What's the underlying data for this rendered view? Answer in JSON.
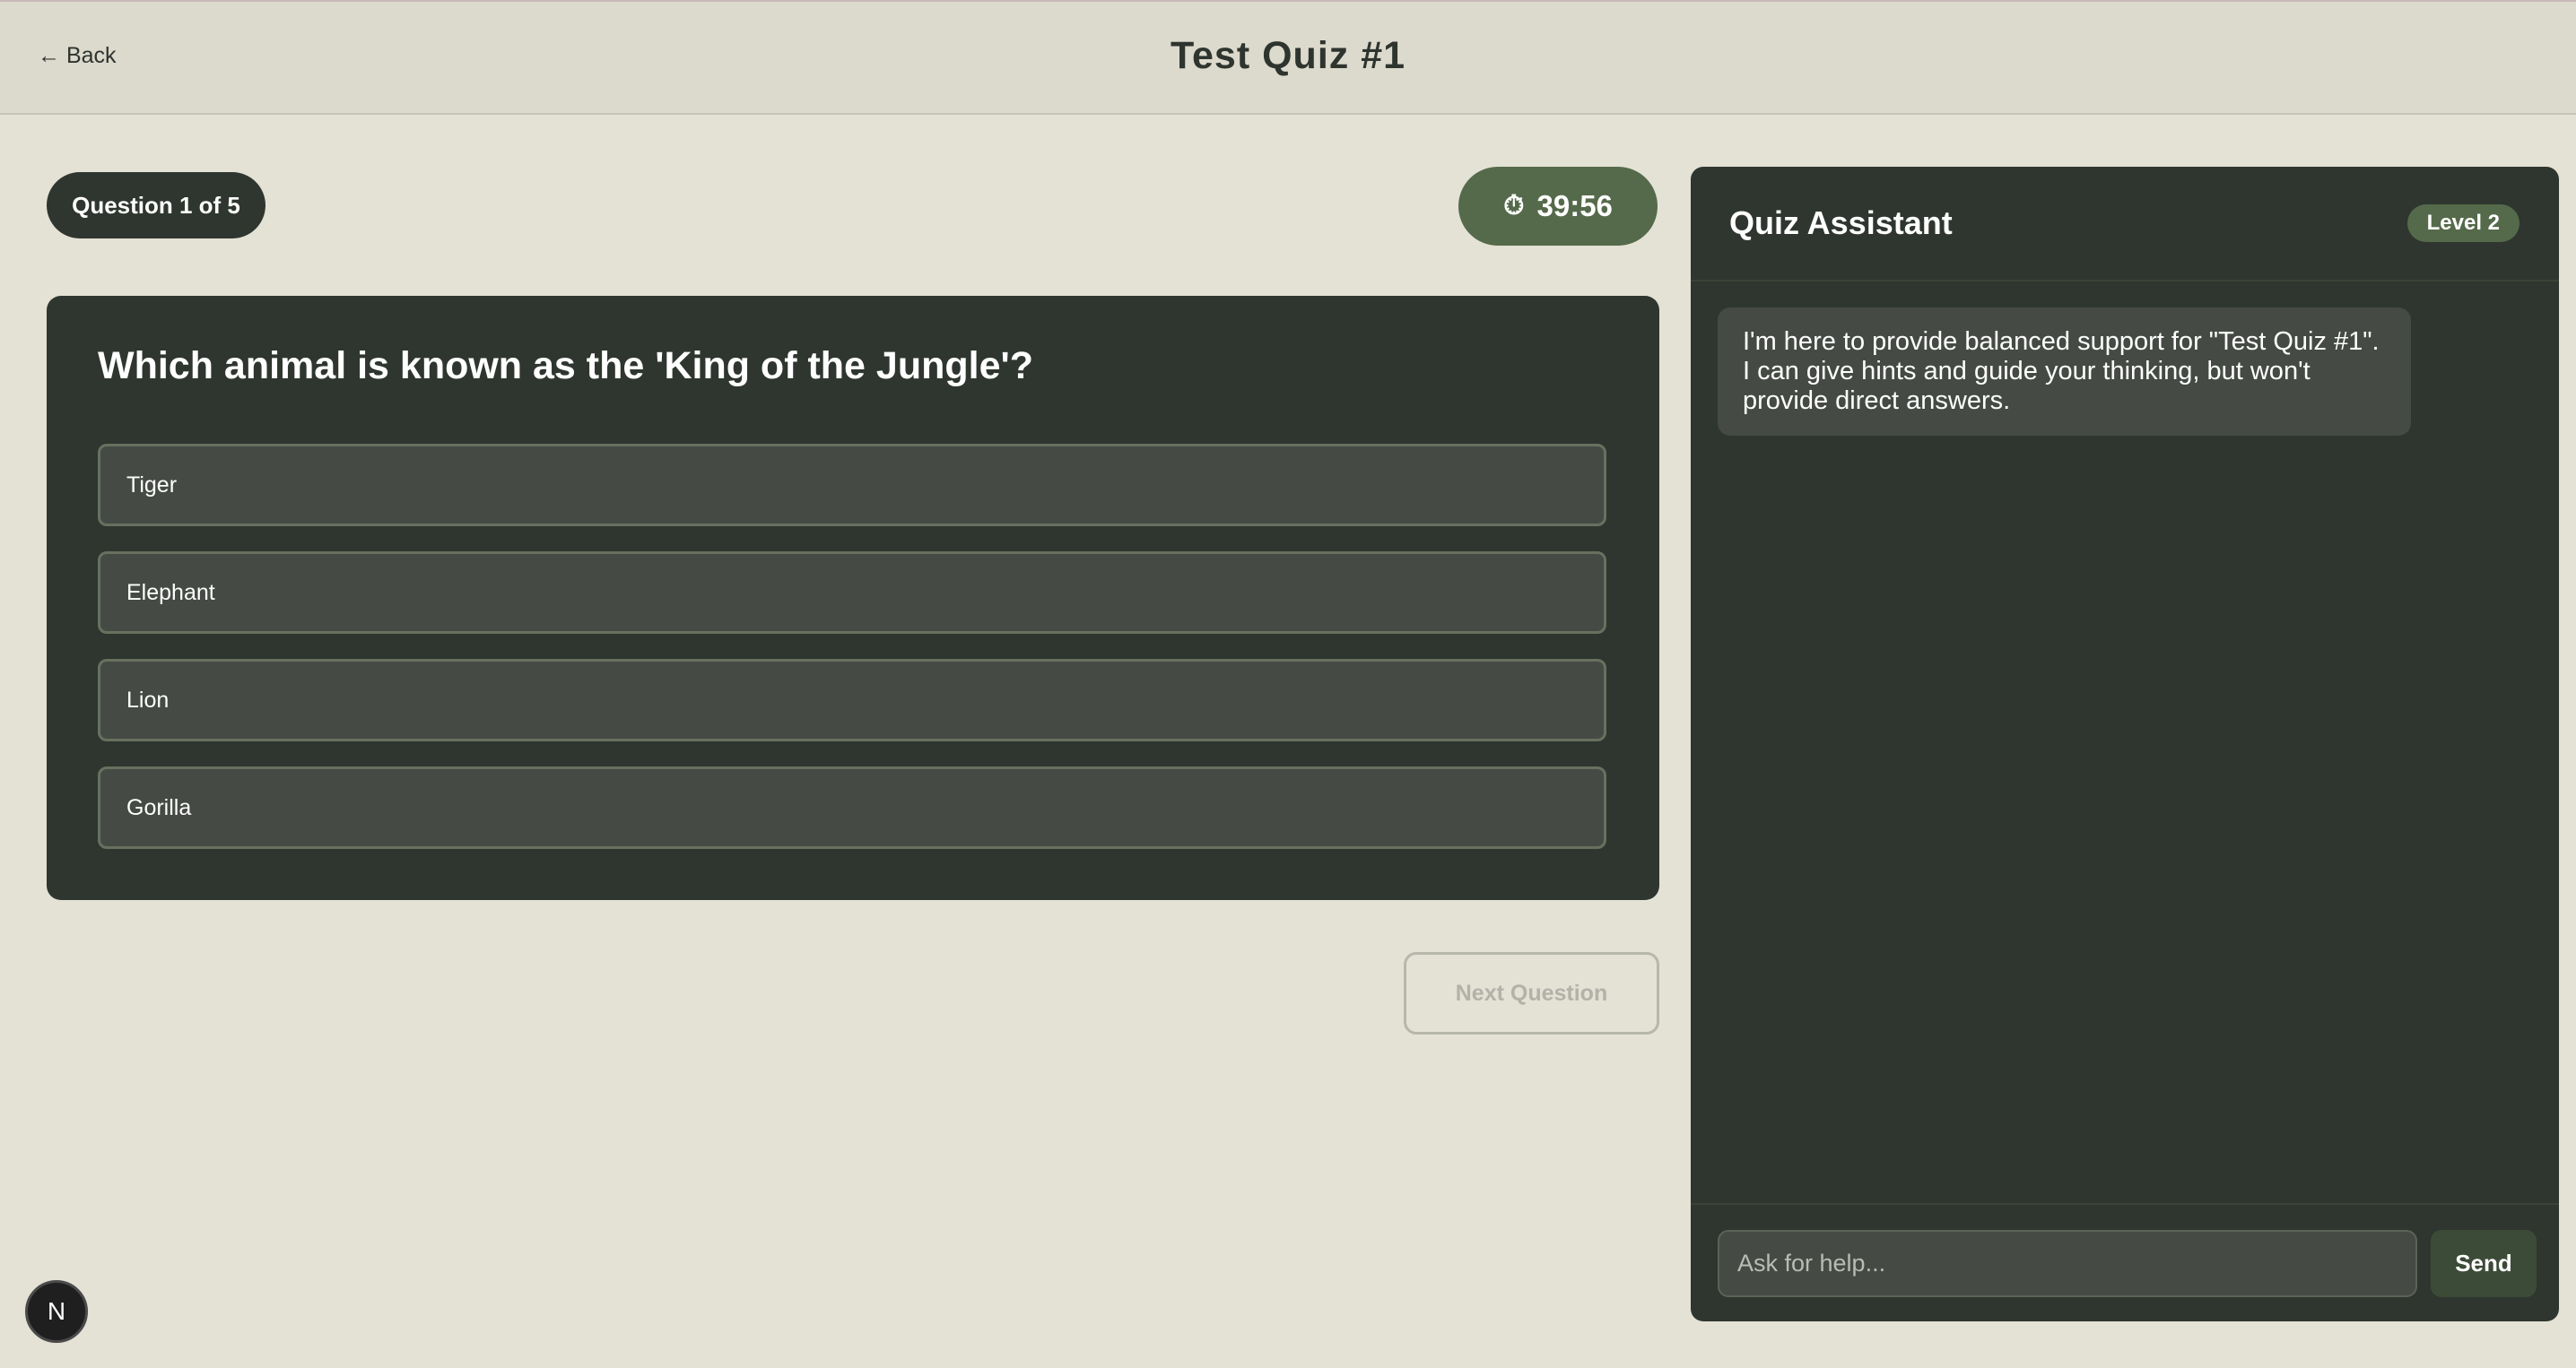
{
  "header": {
    "back_label": "← Back",
    "title": "Test Quiz #1"
  },
  "quiz": {
    "progress_label": "Question 1 of 5",
    "timer_icon": "stopwatch-icon",
    "timer": "39:56",
    "question": "Which animal is known as the 'King of the Jungle'?",
    "options": [
      "Tiger",
      "Elephant",
      "Lion",
      "Gorilla"
    ],
    "next_label": "Next Question"
  },
  "assistant": {
    "title": "Quiz Assistant",
    "level": "Level 2",
    "message": "I'm here to provide balanced support for \"Test Quiz #1\". I can give hints and guide your thinking, but won't provide direct answers.",
    "input_placeholder": "Ask for help...",
    "send_label": "Send"
  },
  "badge": {
    "letter": "N"
  },
  "colors": {
    "background": "#e4e1d5",
    "panel": "#2e362f",
    "accent": "#556a4b"
  }
}
